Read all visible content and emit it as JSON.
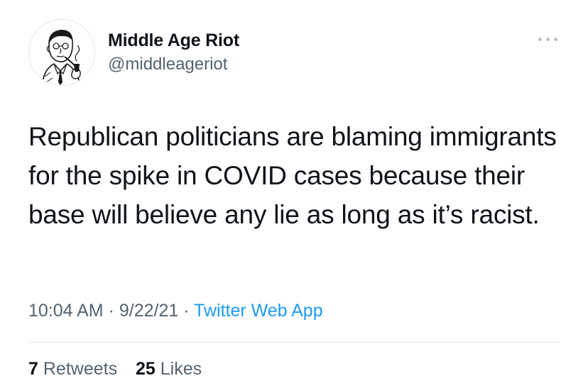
{
  "author": {
    "display_name": "Middle Age Riot",
    "handle": "@middleageriot",
    "avatar_icon": "vintage-man-smoking-pipe-illustration"
  },
  "menu": {
    "icon": "more-horizontal-icon"
  },
  "tweet": {
    "text": "Republican politicians are blaming immigrants for the spike in COVID cases because their base will believe any lie as long as it’s racist."
  },
  "meta": {
    "time": "10:04 AM",
    "separator": " · ",
    "date": "9/22/21",
    "separator2": " · ",
    "source": "Twitter Web App"
  },
  "stats": {
    "retweets_count": "7",
    "retweets_label": "Retweets",
    "likes_count": "25",
    "likes_label": "Likes"
  },
  "colors": {
    "text_primary": "#0f1419",
    "text_secondary": "#536471",
    "link": "#1d9bf0",
    "divider": "#e1e6ea"
  }
}
